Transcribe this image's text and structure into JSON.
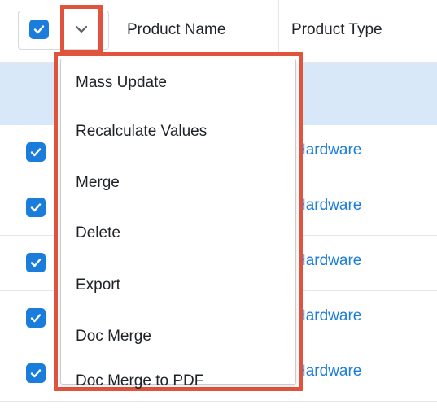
{
  "table": {
    "columns": [
      "Product Name",
      "Product Type"
    ],
    "select_all_checked": true,
    "rows": [
      {
        "product_type": "Hardware",
        "checked": true
      },
      {
        "product_type": "Hardware",
        "checked": true
      },
      {
        "product_type": "Hardware",
        "checked": true
      },
      {
        "product_type": "Hardware",
        "checked": true
      },
      {
        "product_type": "Hardware",
        "checked": true
      }
    ]
  },
  "actions_menu": {
    "items": [
      {
        "label": "Mass Update"
      },
      {
        "label": "Recalculate Values"
      },
      {
        "label": "Merge"
      },
      {
        "label": "Delete"
      },
      {
        "label": "Export"
      },
      {
        "label": "Doc Merge"
      },
      {
        "label": "Doc Merge to PDF"
      }
    ]
  },
  "icons": {
    "select_all": "checkbox-checked-icon",
    "menu_toggle": "chevron-down-icon",
    "row_select": "checkbox-checked-icon"
  },
  "colors": {
    "accent": "#1a7ddb",
    "highlight_border": "#e0543d",
    "selected_row_bg": "#d9e8f8",
    "text": "#1f2328"
  }
}
